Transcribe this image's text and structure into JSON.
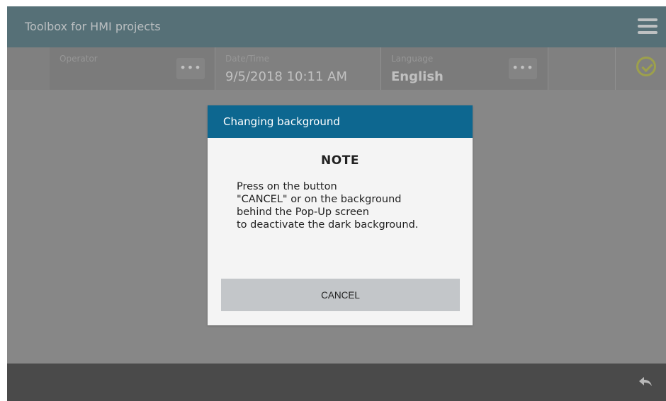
{
  "app": {
    "title": "Toolbox for HMI projects"
  },
  "infobar": {
    "operator": {
      "label": "Operator",
      "value": ""
    },
    "datetime": {
      "label": "Date/Time",
      "value": "9/5/2018 10:11 AM"
    },
    "language": {
      "label": "Language",
      "value": "English"
    },
    "more_label": "•••"
  },
  "dialog": {
    "title": "Changing background",
    "heading": "NOTE",
    "lines": [
      "Press on the button",
      "\"CANCEL\" or on the background",
      "behind the Pop-Up screen",
      "to deactivate the dark background."
    ],
    "cancel_label": "CANCEL"
  },
  "colors": {
    "title_bar": "#6c8c95",
    "dialog_header": "#0d6790",
    "status_ok": "#c5c95f",
    "bottom_bar": "#5d5d5d"
  },
  "icons": {
    "menu": "hamburger-menu-icon",
    "status": "check-circle-icon",
    "back": "back-arrow-icon"
  }
}
